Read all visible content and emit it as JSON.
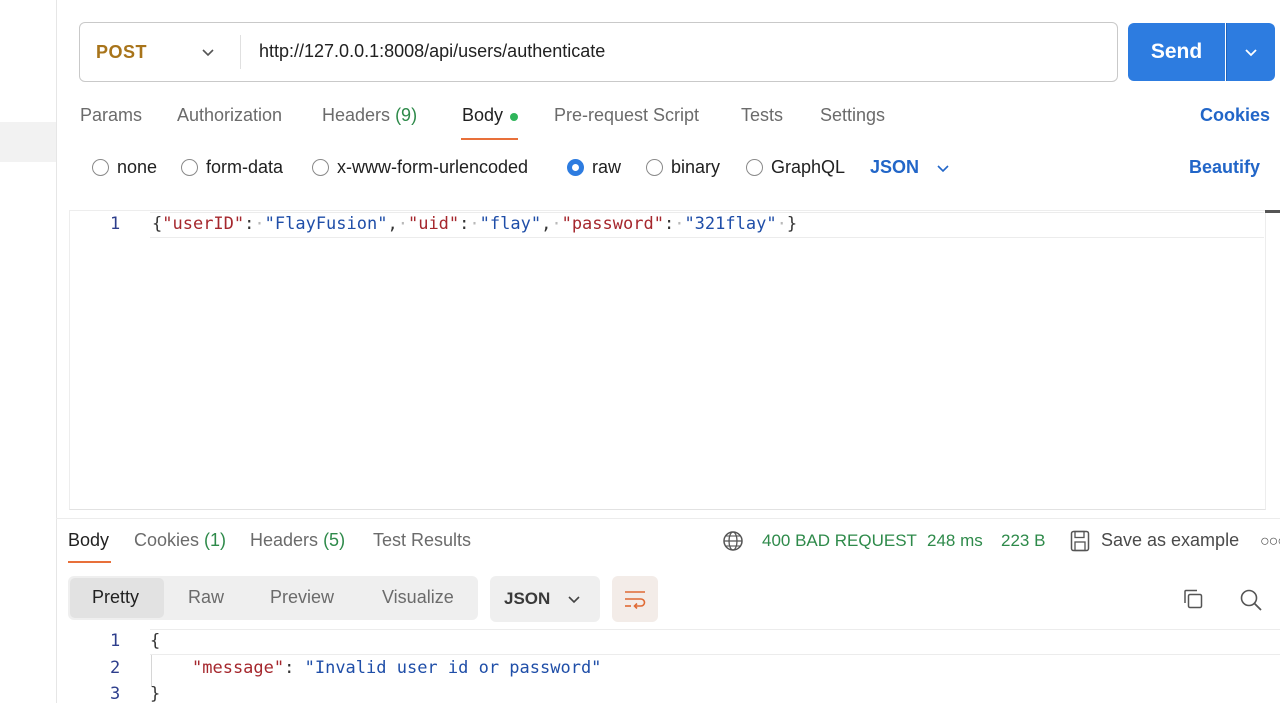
{
  "request": {
    "method": "POST",
    "url": "http://127.0.0.1:8008/api/users/authenticate",
    "send_label": "Send"
  },
  "request_tabs": [
    {
      "label": "Params",
      "count": ""
    },
    {
      "label": "Authorization",
      "count": ""
    },
    {
      "label": "Headers",
      "count": "(9)"
    },
    {
      "label": "Body",
      "count": ""
    },
    {
      "label": "Pre-request Script",
      "count": ""
    },
    {
      "label": "Tests",
      "count": ""
    },
    {
      "label": "Settings",
      "count": ""
    }
  ],
  "cookies_label": "Cookies",
  "body_types": [
    "none",
    "form-data",
    "x-www-form-urlencoded",
    "raw",
    "binary",
    "GraphQL"
  ],
  "body_type_selected": "raw",
  "body_format": "JSON",
  "beautify_label": "Beautify",
  "request_body": {
    "line_number": "1",
    "open": "{",
    "k1": "\"userID\"",
    "v1": "\"FlayFusion\"",
    "k2": "\"uid\"",
    "v2": "\"flay\"",
    "k3": "\"password\"",
    "v3": "\"321flay\"",
    "close": "}"
  },
  "response_tabs": [
    {
      "label": "Body",
      "count": ""
    },
    {
      "label": "Cookies",
      "count": "(1)"
    },
    {
      "label": "Headers",
      "count": "(5)"
    },
    {
      "label": "Test Results",
      "count": ""
    }
  ],
  "response_meta": {
    "status": "400 BAD REQUEST",
    "time": "248 ms",
    "size": "223 B",
    "save_label": "Save as example"
  },
  "view_tabs": [
    "Pretty",
    "Raw",
    "Preview",
    "Visualize"
  ],
  "response_format": "JSON",
  "response_body": {
    "lines": [
      "1",
      "2",
      "3"
    ],
    "open": "{",
    "key": "\"message\"",
    "value": "\"Invalid user id or password\"",
    "close": "}"
  },
  "colors": {
    "accent": "#2d7ce0",
    "tab_underline": "#e8703a",
    "status_green": "#2e8a4a",
    "method_post": "#a8741a",
    "json_key": "#a5272d",
    "json_string": "#1f4ea8"
  }
}
